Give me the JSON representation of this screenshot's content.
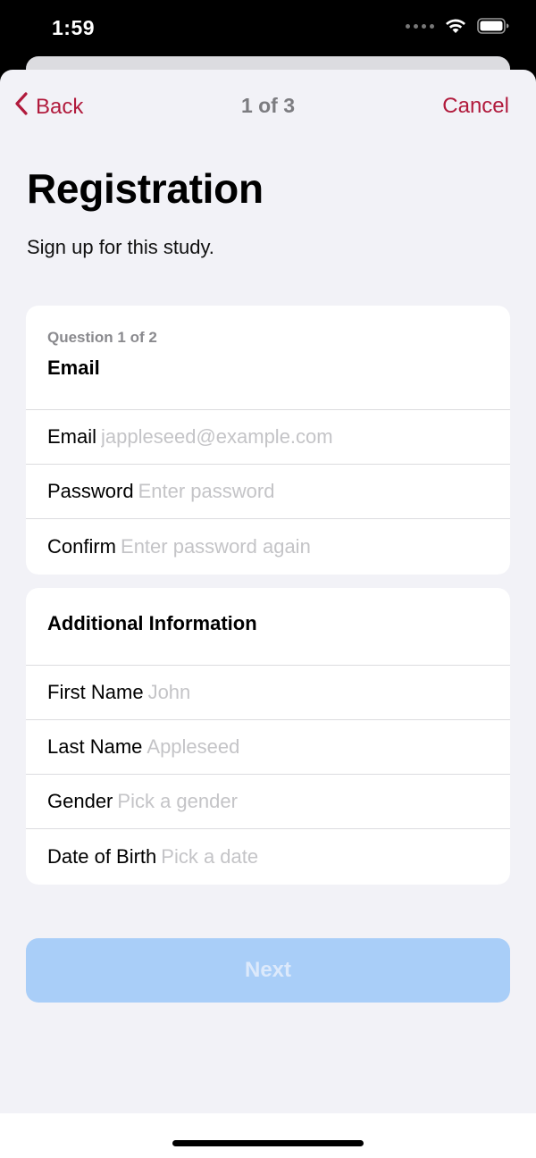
{
  "status_bar": {
    "time": "1:59",
    "icons": [
      "signal-dots-icon",
      "wifi-icon",
      "battery-icon"
    ]
  },
  "nav": {
    "back_label": "Back",
    "step": "1 of 3",
    "cancel_label": "Cancel",
    "accent_color": "#b11a3c"
  },
  "header": {
    "title": "Registration",
    "subtitle": "Sign up for this study."
  },
  "email_section": {
    "counter": "Question 1 of 2",
    "title": "Email",
    "fields": [
      {
        "label": "Email",
        "placeholder": "jappleseed@example.com",
        "value": ""
      },
      {
        "label": "Password",
        "placeholder": "Enter password",
        "value": ""
      },
      {
        "label": "Confirm",
        "placeholder": "Enter password again",
        "value": ""
      }
    ]
  },
  "info_section": {
    "title": "Additional Information",
    "fields": [
      {
        "label": "First Name",
        "placeholder": "John",
        "value": ""
      },
      {
        "label": "Last Name",
        "placeholder": "Appleseed",
        "value": ""
      },
      {
        "label": "Gender",
        "placeholder": "Pick a gender",
        "value": ""
      },
      {
        "label": "Date of Birth",
        "placeholder": "Pick a date",
        "value": ""
      }
    ]
  },
  "next_button": {
    "label": "Next",
    "enabled": false,
    "color": "#a9cef8"
  }
}
